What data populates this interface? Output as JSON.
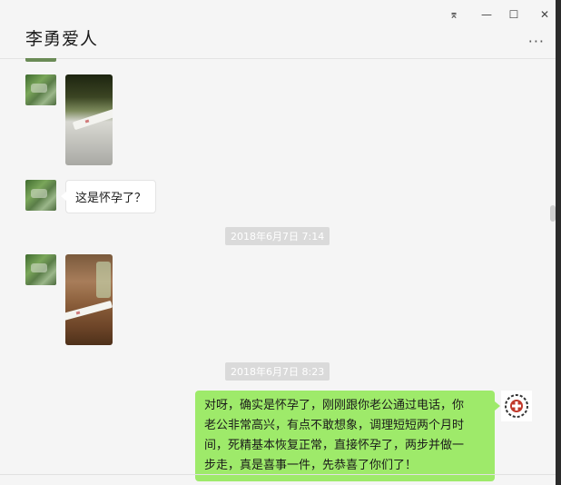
{
  "window": {
    "title": "李勇爱人",
    "controls": {
      "pin": "⌆",
      "minimize": "—",
      "maximize": "☐",
      "close": "✕"
    },
    "more": "···"
  },
  "messages": [
    {
      "side": "left",
      "type": "image",
      "description_icon": "photo"
    },
    {
      "side": "left",
      "type": "text",
      "text": "这是怀孕了？"
    },
    {
      "type": "timestamp",
      "text": "2018年6月7日 7:14"
    },
    {
      "side": "left",
      "type": "image",
      "description_icon": "photo"
    },
    {
      "type": "timestamp",
      "text": "2018年6月7日 8:23"
    },
    {
      "side": "right",
      "type": "text",
      "lines": [
        "对呀，确实是怀孕了，刚刚跟你老公通过电话，你",
        "老公非常高兴，有点不敢想象，调理短短两个月时",
        "间，死精基本恢复正常，直接怀孕了，两步并做一",
        "步走，真是喜事一件，先恭喜了你们了！"
      ]
    }
  ],
  "colors": {
    "accent_bubble": "#9eea6a",
    "background": "#f5f5f5",
    "timestamp_bg": "#dadada"
  }
}
